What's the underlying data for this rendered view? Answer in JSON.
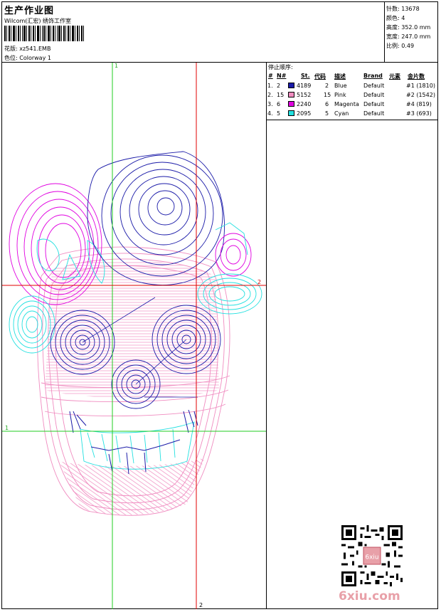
{
  "header": {
    "title": "生产作业图",
    "company": "Wilcom(汇宏) 绣饰工作室",
    "design_label": "花版:",
    "design_value": "xz541.EMB",
    "colorway_label": "色位:",
    "colorway_value": "Colorway 1"
  },
  "info": [
    {
      "label": "针数:",
      "value": "13678"
    },
    {
      "label": "颜色:",
      "value": "4"
    },
    {
      "label": "高度:",
      "value": "352.0 mm"
    },
    {
      "label": "宽度:",
      "value": "247.0 mm"
    },
    {
      "label": "比例:",
      "value": "0.49"
    }
  ],
  "legend": {
    "title": "停止顺序:",
    "headers": {
      "idx": "#",
      "n": "N#",
      "st": "St.",
      "code": "代码",
      "desc": "描述",
      "brand": "Brand",
      "elem": "元素",
      "spangle": "金片数"
    },
    "rows": [
      {
        "idx": "1.",
        "n": "2",
        "color": "#1a1aa8",
        "st": "4189",
        "code": "2",
        "desc": "Blue",
        "brand": "Default",
        "spangle": "#1 (1810)"
      },
      {
        "idx": "2.",
        "n": "15",
        "color": "#f08cc0",
        "st": "5152",
        "code": "15",
        "desc": "Pink",
        "brand": "Default",
        "spangle": "#2 (1542)"
      },
      {
        "idx": "3.",
        "n": "6",
        "color": "#e000e0",
        "st": "2240",
        "code": "6",
        "desc": "Magenta",
        "brand": "Default",
        "spangle": "#4 (819)"
      },
      {
        "idx": "4.",
        "n": "5",
        "color": "#22e0e0",
        "st": "2095",
        "code": "5",
        "desc": "Cyan",
        "brand": "Default",
        "spangle": "#3 (693)"
      }
    ]
  },
  "guides": {
    "green_top": "1",
    "green_left": "1",
    "red_right": "2",
    "red_bottom": "2"
  },
  "colors": {
    "blue": "#1a1aa8",
    "pink": "#f08cc0",
    "magenta": "#e000e0",
    "cyan": "#22e0e0",
    "green": "#22cc22",
    "red": "#e00000",
    "site": "#e8a0a8"
  },
  "site": "6xiu.com",
  "qr_stamp": "6xiu"
}
